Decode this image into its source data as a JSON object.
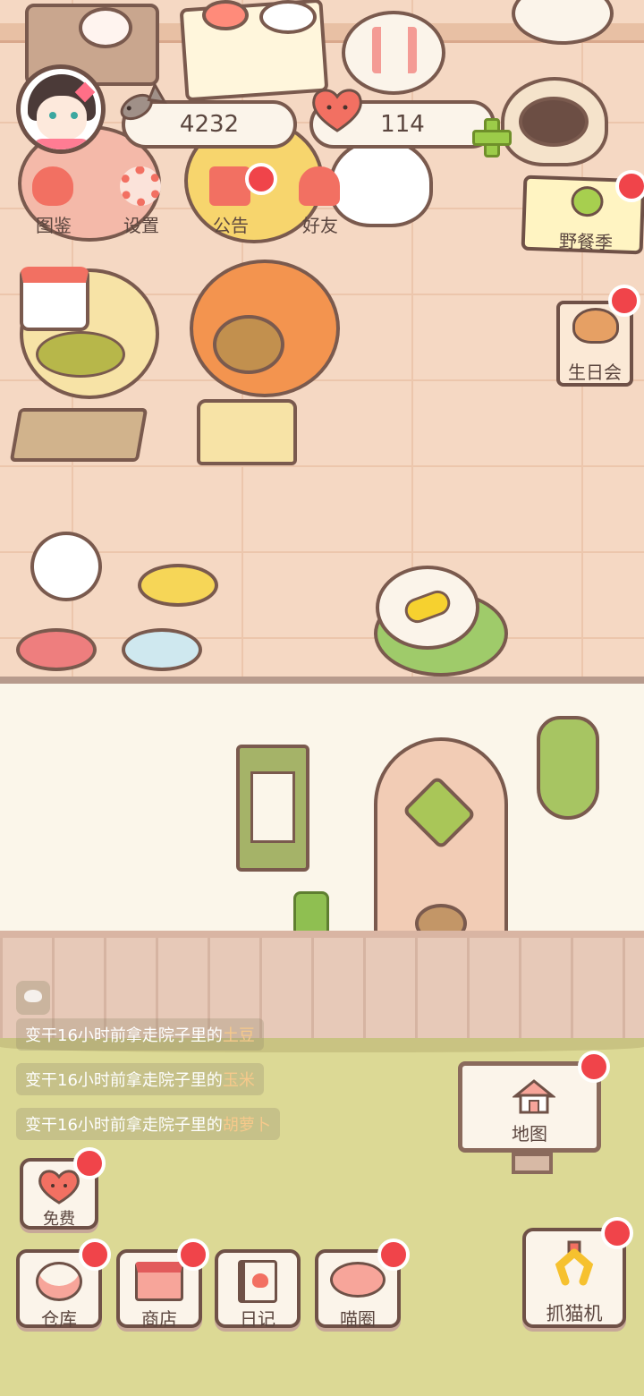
{
  "hud": {
    "fish_count": "4232",
    "heart_count": "114"
  },
  "top_nav": [
    {
      "label": "图鉴",
      "icon": "cat-head-icon"
    },
    {
      "label": "设置",
      "icon": "gear-icon"
    },
    {
      "label": "公告",
      "icon": "gift-icon"
    },
    {
      "label": "好友",
      "icon": "friends-icon"
    }
  ],
  "events": {
    "picnic": "野餐季",
    "birthday": "生日会"
  },
  "notifications": [
    {
      "prefix": "变干16小时前拿走院子里的",
      "item": "土豆"
    },
    {
      "prefix": "变干16小时前拿走院子里的",
      "item": "玉米"
    },
    {
      "prefix": "变干16小时前拿走院子里的",
      "item": "胡萝卜"
    }
  ],
  "buttons": {
    "free": "免费",
    "map": "地图",
    "warehouse": "仓库",
    "shop": "商店",
    "diary": "日记",
    "circle": "喵圈",
    "claw": "抓猫机"
  },
  "colors": {
    "accent_red": "#f0444a",
    "outline": "#6f5147",
    "grass": "#dcd995"
  }
}
